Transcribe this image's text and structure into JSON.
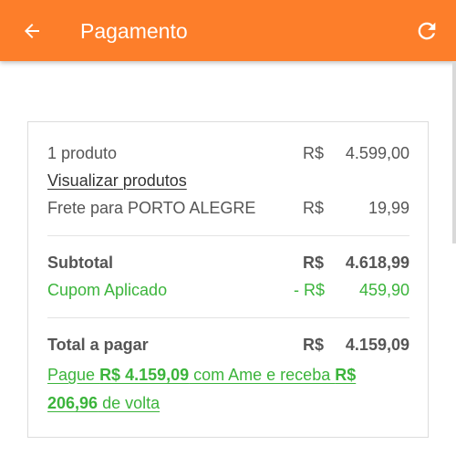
{
  "header": {
    "title": "Pagamento",
    "back_icon": "arrow-left-icon",
    "refresh_icon": "refresh-icon",
    "bg_color": "#fd7e2a"
  },
  "summary": {
    "products_label": "1 produto",
    "products_currency": "R$",
    "products_amount": "4.599,00",
    "view_products_link": "Visualizar produtos",
    "shipping_label": "Frete para PORTO ALEGRE",
    "shipping_currency": "R$",
    "shipping_amount": "19,99",
    "subtotal_label": "Subtotal",
    "subtotal_currency": "R$",
    "subtotal_amount": "4.618,99",
    "coupon_label": "Cupom Aplicado",
    "coupon_currency": "- R$",
    "coupon_amount": "459,90",
    "total_label": "Total a pagar",
    "total_currency": "R$",
    "total_amount": "4.159,09"
  },
  "ame_offer": {
    "prefix": "Pague ",
    "pay_amount": "R$ 4.159,09",
    "middle": " com Ame e receba ",
    "cashback_amount": "R$ 206,96",
    "suffix": " de volta"
  },
  "colors": {
    "accent_green": "#3bb43b",
    "text_gray": "#555555"
  }
}
